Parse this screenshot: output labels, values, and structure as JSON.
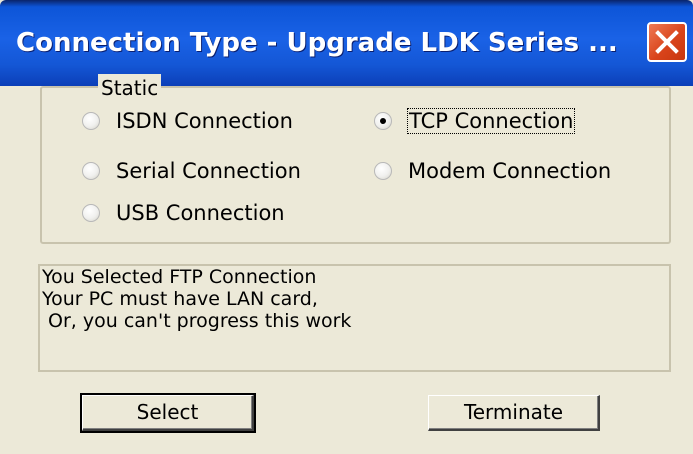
{
  "window": {
    "title": "Connection Type - Upgrade LDK Series ..."
  },
  "group": {
    "legend": "Static",
    "options": [
      {
        "label": "ISDN Connection",
        "selected": false
      },
      {
        "label": "TCP Connection",
        "selected": true
      },
      {
        "label": "Serial Connection",
        "selected": false
      },
      {
        "label": "Modem Connection",
        "selected": false
      },
      {
        "label": "USB Connection",
        "selected": false
      }
    ]
  },
  "message": {
    "lines": [
      "You Selected FTP Connection",
      "Your PC must have LAN card,",
      " Or, you can't progress this work"
    ]
  },
  "buttons": {
    "select": "Select",
    "terminate": "Terminate"
  },
  "colors": {
    "titlebar": "#1a62e6",
    "close": "#d9441b",
    "face": "#ece9d8"
  }
}
